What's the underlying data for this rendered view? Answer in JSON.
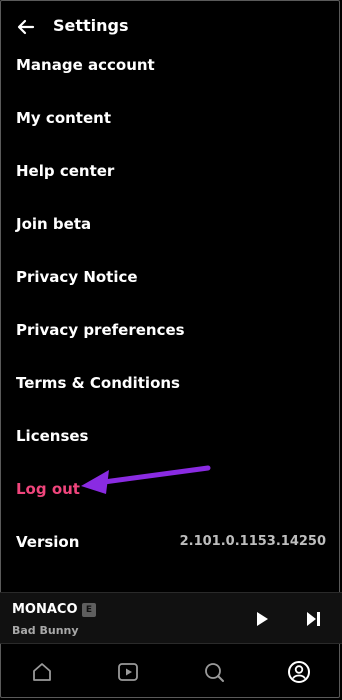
{
  "header": {
    "title": "Settings",
    "back_icon": "arrow-left-icon"
  },
  "menu": {
    "items": [
      {
        "label": "Manage account"
      },
      {
        "label": "My content"
      },
      {
        "label": "Help center"
      },
      {
        "label": "Join beta"
      },
      {
        "label": "Privacy Notice"
      },
      {
        "label": "Privacy preferences"
      },
      {
        "label": "Terms & Conditions"
      },
      {
        "label": "Licenses"
      },
      {
        "label": "Log out",
        "color": "#f0457c"
      }
    ],
    "version_label": "Version",
    "version_value": "2.101.0.1153.14250"
  },
  "annotation": {
    "arrow_color": "#8a2be2",
    "icon": "arrow-pointer-icon"
  },
  "now_playing": {
    "title": "MONACO",
    "explicit": "E",
    "artist": "Bad Bunny"
  },
  "bottom_nav": [
    {
      "icon": "home-icon"
    },
    {
      "icon": "video-play-icon"
    },
    {
      "icon": "search-icon"
    },
    {
      "icon": "profile-icon",
      "active": true
    }
  ]
}
